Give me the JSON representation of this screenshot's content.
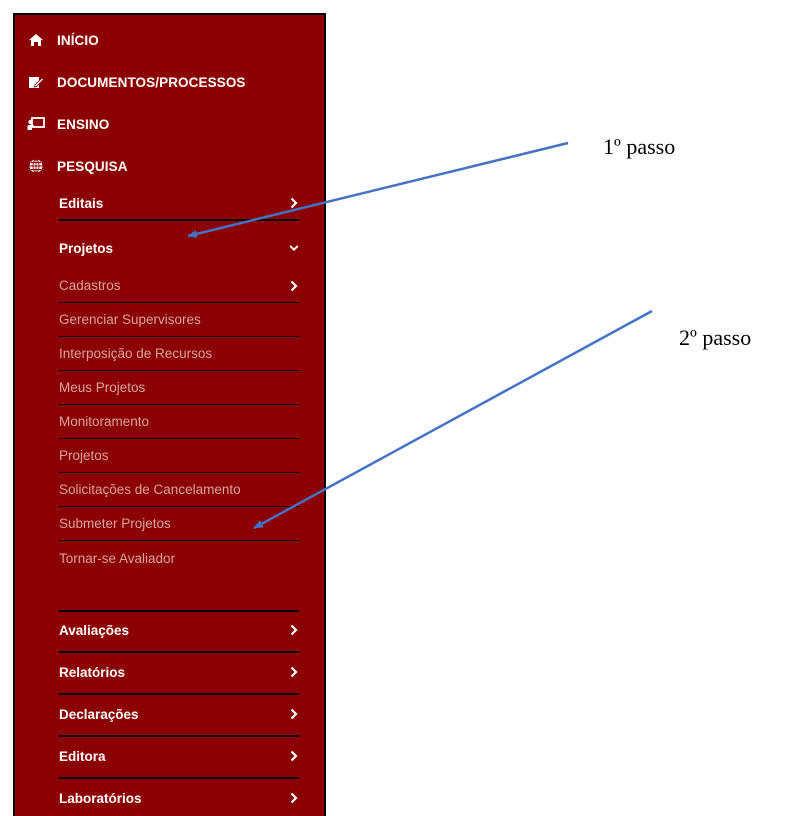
{
  "sidebar": {
    "top_items": [
      {
        "label": "INÍCIO",
        "icon": "home-icon"
      },
      {
        "label": "DOCUMENTOS/PROCESSOS",
        "icon": "document-edit-icon"
      },
      {
        "label": "ENSINO",
        "icon": "presentation-board-icon"
      },
      {
        "label": "PESQUISA",
        "icon": "globe-icon"
      }
    ],
    "pesquisa_items": {
      "editais": "Editais",
      "projetos": "Projetos",
      "avaliacoes": "Avaliações",
      "relatorios": "Relatórios",
      "declaracoes": "Declarações",
      "editora": "Editora",
      "laboratorios": "Laboratórios"
    },
    "projetos_items": [
      "Cadastros",
      "Gerenciar Supervisores",
      "Interposição de Recursos",
      "Meus Projetos",
      "Monitoramento",
      "Projetos",
      "Solicitações de Cancelamento",
      "Submeter Projetos",
      "Tornar-se Avaliador"
    ]
  },
  "annotations": {
    "step1": "1º passo",
    "step2": "2º passo"
  },
  "colors": {
    "sidebar_bg": "#8b0000",
    "submenu_text": "#d9a3a3",
    "arrow": "#4472c4"
  }
}
